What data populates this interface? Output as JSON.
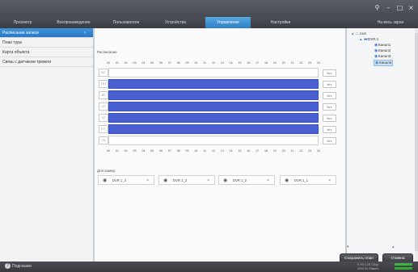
{
  "window": {
    "controls": [
      "⚲",
      "–",
      "□",
      "×"
    ]
  },
  "menu": [
    "Просмотр",
    "Воспроизведение",
    "Пользователи",
    "Устройства",
    "Управление",
    "Настройки",
    "На весь экран"
  ],
  "left_panel": {
    "items": [
      "Расписание записи",
      "План тура",
      "Карта объекта",
      "Связь с датчиком тревоги"
    ]
  },
  "schedule": {
    "label": "Расписание",
    "hours": [
      "00",
      "01",
      "02",
      "03",
      "04",
      "05",
      "06",
      "07",
      "08",
      "09",
      "10",
      "11",
      "12",
      "13",
      "14",
      "15",
      "16",
      "17",
      "18",
      "19",
      "20",
      "21",
      "22",
      "23",
      "24"
    ],
    "days": [
      {
        "label": "ВС",
        "filled": false,
        "button": "Уст."
      },
      {
        "label": "ПН",
        "filled": true,
        "button": "Уст."
      },
      {
        "label": "ВТ",
        "filled": true,
        "button": "Уст."
      },
      {
        "label": "СР",
        "filled": true,
        "button": "Уст."
      },
      {
        "label": "ЧТ",
        "filled": true,
        "button": "Уст."
      },
      {
        "label": "ПТ",
        "filled": true,
        "button": "Уст."
      },
      {
        "label": "СБ",
        "filled": false,
        "button": "Уст."
      }
    ]
  },
  "cameras": {
    "label": "Для камер:",
    "items": [
      "DVR 1_4",
      "DVR 1_3",
      "DVR 1_2",
      "DVR 1_1"
    ]
  },
  "tree": {
    "root": "root",
    "device": "DVR 1",
    "channels": [
      "Канал1",
      "Канал2",
      "Канал3",
      "Канал4"
    ]
  },
  "buttons": {
    "save": "Сохранить план",
    "cancel": "Отмена"
  },
  "status": {
    "help": "Подсказки",
    "line1": "0.7/0.1.2Б   Сбор",
    "line2": "0/0/0 00   Память"
  }
}
